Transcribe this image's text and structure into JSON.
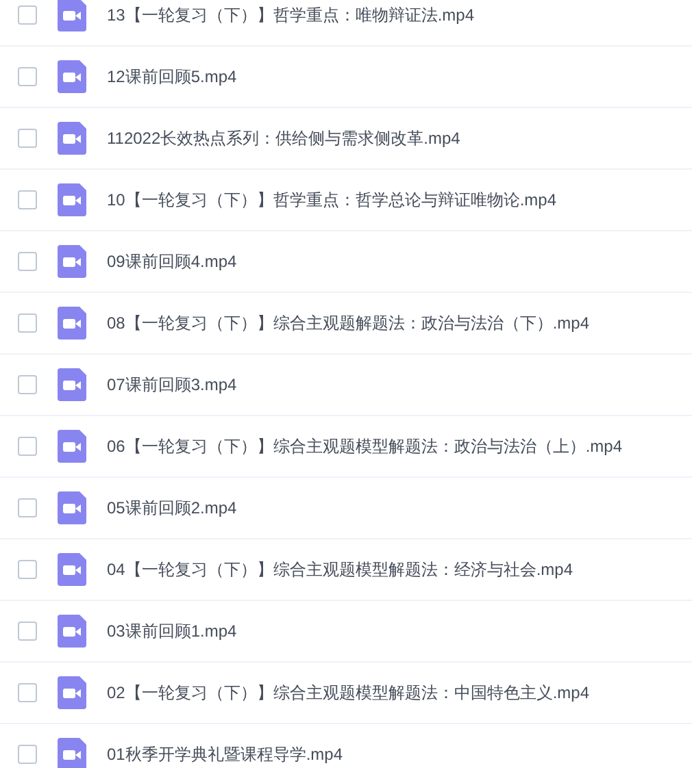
{
  "files": [
    {
      "name": "13【一轮复习（下）】哲学重点：唯物辩证法.mp4",
      "checked": false
    },
    {
      "name": "12课前回顾5.mp4",
      "checked": false
    },
    {
      "name": "112022长效热点系列：供给侧与需求侧改革.mp4",
      "checked": false
    },
    {
      "name": "10【一轮复习（下）】哲学重点：哲学总论与辩证唯物论.mp4",
      "checked": false
    },
    {
      "name": "09课前回顾4.mp4",
      "checked": false
    },
    {
      "name": "08【一轮复习（下）】综合主观题解题法：政治与法治（下）.mp4",
      "checked": false
    },
    {
      "name": "07课前回顾3.mp4",
      "checked": false
    },
    {
      "name": "06【一轮复习（下）】综合主观题模型解题法：政治与法治（上）.mp4",
      "checked": false
    },
    {
      "name": "05课前回顾2.mp4",
      "checked": false
    },
    {
      "name": "04【一轮复习（下）】综合主观题模型解题法：经济与社会.mp4",
      "checked": false
    },
    {
      "name": "03课前回顾1.mp4",
      "checked": false
    },
    {
      "name": "02【一轮复习（下）】综合主观题模型解题法：中国特色主义.mp4",
      "checked": false
    },
    {
      "name": "01秋季开学典礼暨课程导学.mp4",
      "checked": false
    }
  ]
}
